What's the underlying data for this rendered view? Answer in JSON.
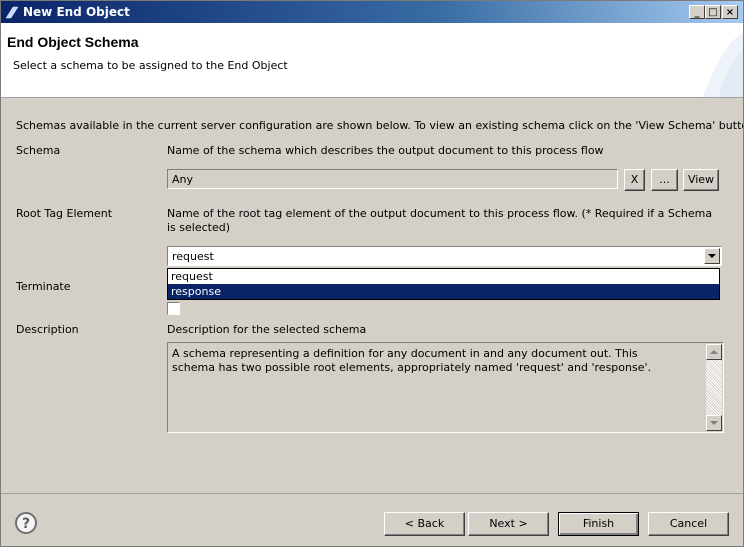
{
  "window": {
    "title": "New End Object"
  },
  "header": {
    "title": "End Object Schema",
    "subtitle": "Select a schema to be assigned to the End Object"
  },
  "intro": "Schemas available in the current server configuration are shown below. To view an existing schema click on the 'View Schema' button",
  "schema": {
    "label": "Schema",
    "help": "Name of the schema which describes the output document to this process flow",
    "value": "Any",
    "clear_label": "X",
    "browse_label": "...",
    "view_label": "View"
  },
  "root_tag": {
    "label": "Root Tag Element",
    "help": "Name of the root tag element of the output document to this process flow. (* Required if a Schema is selected)",
    "value": "request",
    "options": [
      "request",
      "response"
    ],
    "highlighted": "response"
  },
  "terminate": {
    "label": "Terminate",
    "checked": false
  },
  "description": {
    "label": "Description",
    "help": "Description for the selected schema",
    "text": "A schema representing a definition for any document in and any document out. This schema has two possible root elements, appropriately named 'request' and 'response'."
  },
  "footer": {
    "back_label": "< Back",
    "next_label": "Next >",
    "finish_label": "Finish",
    "cancel_label": "Cancel"
  }
}
